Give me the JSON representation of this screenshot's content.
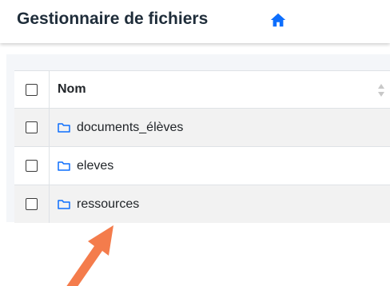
{
  "header": {
    "title": "Gestionnaire de fichiers",
    "home_icon": "home-icon"
  },
  "table": {
    "column_header": "Nom",
    "rows": [
      {
        "name": "documents_élèves",
        "icon": "folder-icon"
      },
      {
        "name": "eleves",
        "icon": "folder-icon"
      },
      {
        "name": "ressources",
        "icon": "folder-icon"
      }
    ]
  },
  "colors": {
    "accent": "#0d6efd",
    "arrow": "#f47c4c",
    "title": "#1f2d3a"
  }
}
